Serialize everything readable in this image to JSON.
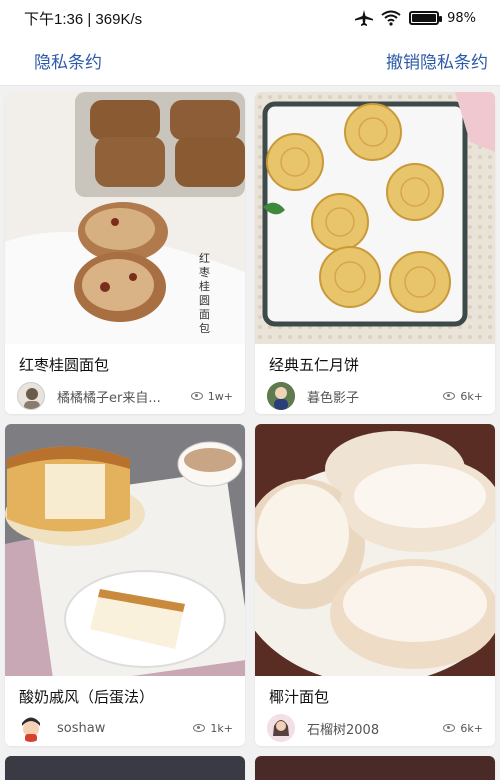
{
  "status_bar": {
    "time_speed": "下午1:36 | 369K/s",
    "battery_percent": "98%",
    "battery_level": 0.98,
    "icons": [
      "airplane-icon",
      "wifi-icon",
      "battery-icon"
    ]
  },
  "top_bar": {
    "privacy_policy": "隐私条约",
    "revoke_privacy_policy": "撤销隐私条约",
    "accent_color": "#2b5aa8"
  },
  "cards": [
    {
      "title": "红枣桂圆面包",
      "author": "橘橘橘子er来自...",
      "views": "1w+",
      "image_caption": "红枣桂圆面包"
    },
    {
      "title": "经典五仁月饼",
      "author": "暮色影子",
      "views": "6k+"
    },
    {
      "title": "酸奶戚风（后蛋法）",
      "author": "soshaw",
      "views": "1k+"
    },
    {
      "title": "椰汁面包",
      "author": "石榴树2008",
      "views": "6k+"
    }
  ]
}
